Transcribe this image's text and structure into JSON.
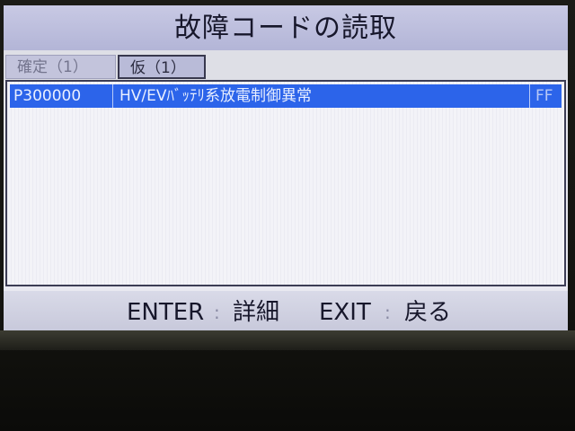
{
  "header": {
    "title": "故障コードの読取"
  },
  "tabs": [
    {
      "label": "確定（1）",
      "active": false
    },
    {
      "label": "仮（1）",
      "active": true
    }
  ],
  "dtc_list": {
    "rows": [
      {
        "code": "P300000",
        "description": "HV/EVﾊﾞｯﾃﾘ系放電制御異常",
        "flag": "FF",
        "selected": true
      }
    ]
  },
  "footer": {
    "enter_key": "ENTER",
    "enter_separator": ":",
    "enter_label": "詳細",
    "exit_key": "EXIT",
    "exit_separator": ":",
    "exit_label": "戻る"
  },
  "colors": {
    "selection": "#2c64ea",
    "title_bar": "#b3b5d7",
    "panel_bg": "#f3f3f8"
  }
}
